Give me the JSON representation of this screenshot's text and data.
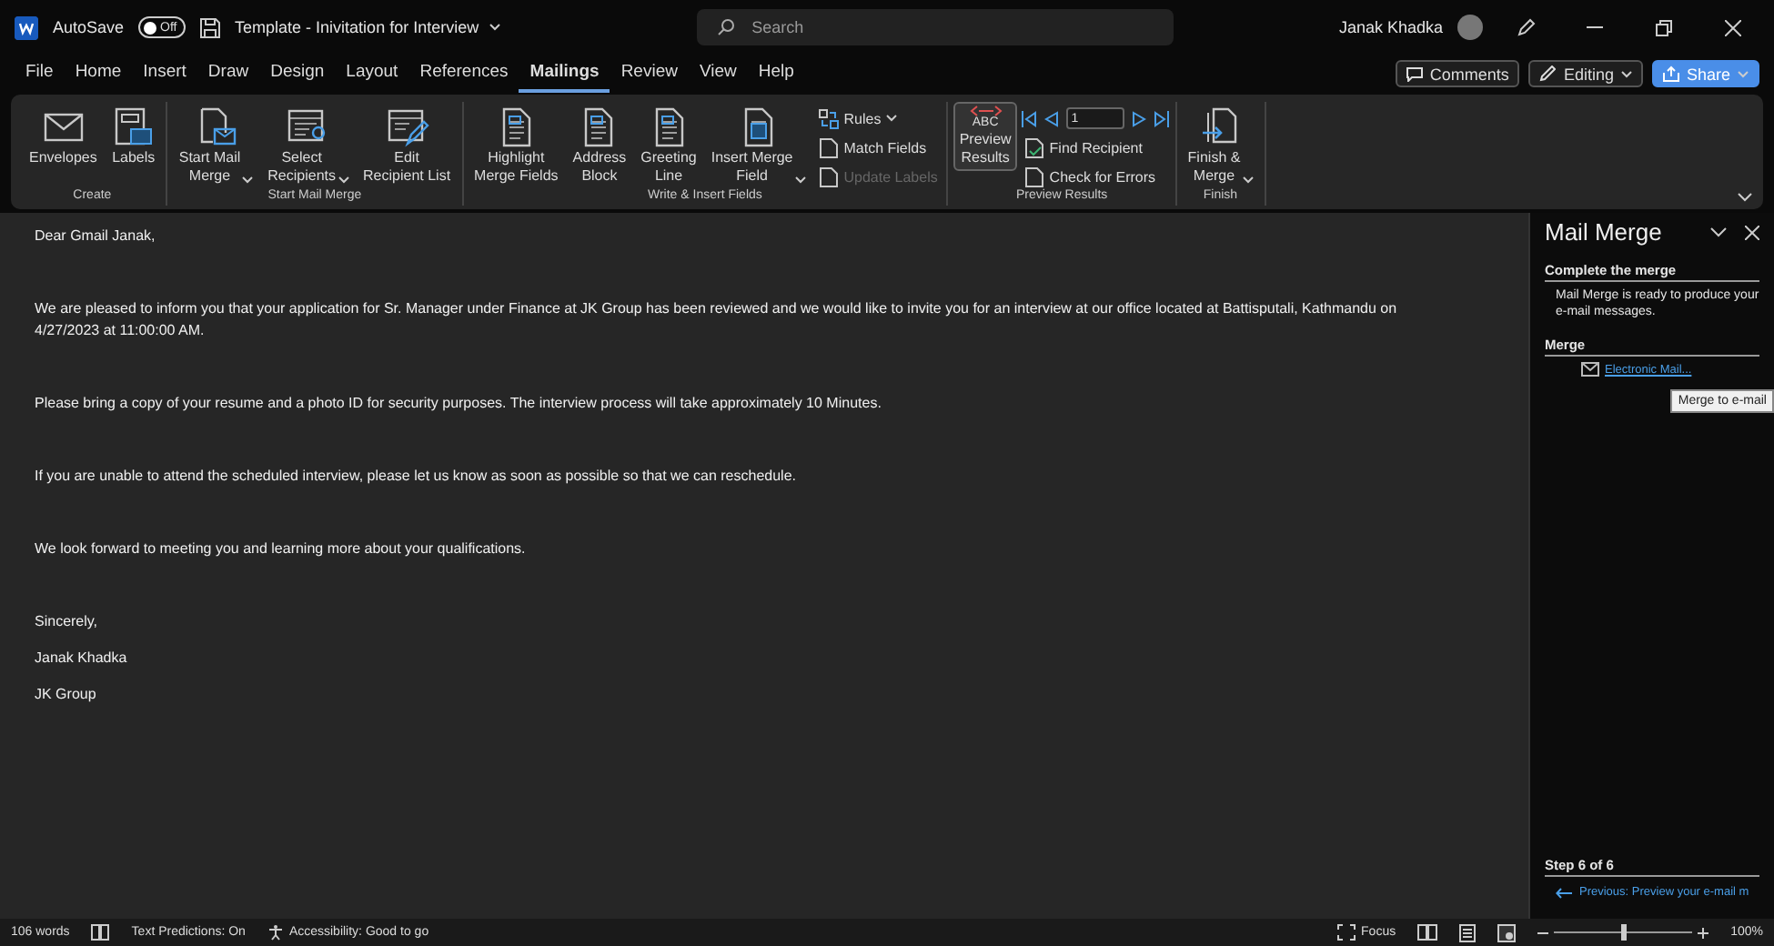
{
  "title_bar": {
    "autosave_label": "AutoSave",
    "autosave_on": false,
    "autosave_state": "Off",
    "document_title": "Template - Inivitation for Interview",
    "search": {
      "placeholder": "Search"
    },
    "user_name": "Janak Khadka"
  },
  "tabs": [
    {
      "label": "File",
      "selected": false
    },
    {
      "label": "Home",
      "selected": false
    },
    {
      "label": "Insert",
      "selected": false
    },
    {
      "label": "Draw",
      "selected": false
    },
    {
      "label": "Design",
      "selected": false
    },
    {
      "label": "Layout",
      "selected": false
    },
    {
      "label": "References",
      "selected": false
    },
    {
      "label": "Mailings",
      "selected": true
    },
    {
      "label": "Review",
      "selected": false
    },
    {
      "label": "View",
      "selected": false
    },
    {
      "label": "Help",
      "selected": false
    }
  ],
  "header_buttons": [
    {
      "kind": "comments",
      "label": "Comments"
    },
    {
      "kind": "editing",
      "label": "Editing"
    },
    {
      "kind": "share",
      "label": "Share"
    }
  ],
  "ribbon_groups": [
    {
      "label": "Create",
      "items": [
        {
          "kind": "large",
          "label": "Envelopes",
          "dropdown": false,
          "pressed": false,
          "disabled": false
        },
        {
          "kind": "large",
          "label": "Labels",
          "dropdown": false,
          "pressed": false,
          "disabled": false
        }
      ]
    },
    {
      "label": "Start Mail Merge",
      "items": [
        {
          "kind": "large",
          "label": "Start Mail\nMerge",
          "dropdown": true,
          "pressed": false,
          "disabled": false
        },
        {
          "kind": "large",
          "label": "Select\nRecipients",
          "dropdown": true,
          "pressed": false,
          "disabled": false
        },
        {
          "kind": "large",
          "label": "Edit\nRecipient List",
          "dropdown": false,
          "pressed": false,
          "disabled": false
        }
      ]
    },
    {
      "label": "Write & Insert Fields",
      "items": [
        {
          "kind": "large",
          "label": "Highlight\nMerge Fields",
          "dropdown": false,
          "pressed": false,
          "disabled": false
        },
        {
          "kind": "large",
          "label": "Address\nBlock",
          "dropdown": false,
          "pressed": false,
          "disabled": false
        },
        {
          "kind": "large",
          "label": "Greeting\nLine",
          "dropdown": false,
          "pressed": false,
          "disabled": false
        },
        {
          "kind": "large",
          "label": "Insert Merge\nField",
          "dropdown": true,
          "pressed": false,
          "disabled": false
        },
        {
          "kind": "column",
          "items": [
            {
              "kind": "small",
              "label": "Rules",
              "dropdown": true,
              "pressed": false,
              "disabled": false
            },
            {
              "kind": "small",
              "label": "Match Fields",
              "dropdown": false,
              "pressed": false,
              "disabled": false
            },
            {
              "kind": "small",
              "label": "Update Labels",
              "dropdown": false,
              "pressed": false,
              "disabled": true
            }
          ]
        }
      ]
    },
    {
      "label": "Preview Results",
      "items": [
        {
          "kind": "large",
          "label": "Preview\nResults",
          "icon_text": "ABC",
          "dropdown": false,
          "pressed": true,
          "disabled": false
        },
        {
          "kind": "column",
          "items": [
            {
              "kind": "nav",
              "value": "1"
            },
            {
              "kind": "small",
              "label": "Find Recipient",
              "dropdown": false,
              "pressed": false,
              "disabled": false
            },
            {
              "kind": "small",
              "label": "Check for Errors",
              "dropdown": false,
              "pressed": false,
              "disabled": false
            }
          ]
        }
      ]
    },
    {
      "label": "Finish",
      "items": [
        {
          "kind": "large",
          "label": "Finish &\nMerge",
          "dropdown": true,
          "pressed": false,
          "disabled": false
        }
      ]
    }
  ],
  "document": {
    "paragraphs": [
      "Dear Gmail Janak,",
      "We are pleased to inform you that your application for Sr. Manager under Finance at JK Group has been reviewed and we would like to invite you for an interview at our office located at Battisputali, Kathmandu on 4/27/2023 at 11:00:00 AM.",
      "Please bring a copy of your resume and a photo ID for security purposes. The interview process will take approximately 10 Minutes.",
      "If you are unable to attend the scheduled interview, please let us know as soon as possible so that we can reschedule.",
      "We look forward to meeting you and learning more about your qualifications."
    ],
    "closing": [
      "Sincerely,",
      "Janak Khadka",
      "JK Group"
    ]
  },
  "task_pane": {
    "title": "Mail Merge",
    "section_1": {
      "heading": "Complete the merge",
      "text": "Mail Merge is ready to produce your e-mail messages."
    },
    "section_2": {
      "heading": "Merge",
      "link": "Electronic Mail..."
    },
    "tooltip": "Merge to e-mail",
    "step": "Step 6 of 6",
    "previous_link": "Previous: Preview your e-mail m"
  },
  "status_bar": {
    "word_count": "106 words",
    "text_predictions": "Text Predictions: On",
    "accessibility": "Accessibility: Good to go",
    "focus": "Focus",
    "zoom": {
      "level": 0.5,
      "reading": "100%"
    }
  }
}
